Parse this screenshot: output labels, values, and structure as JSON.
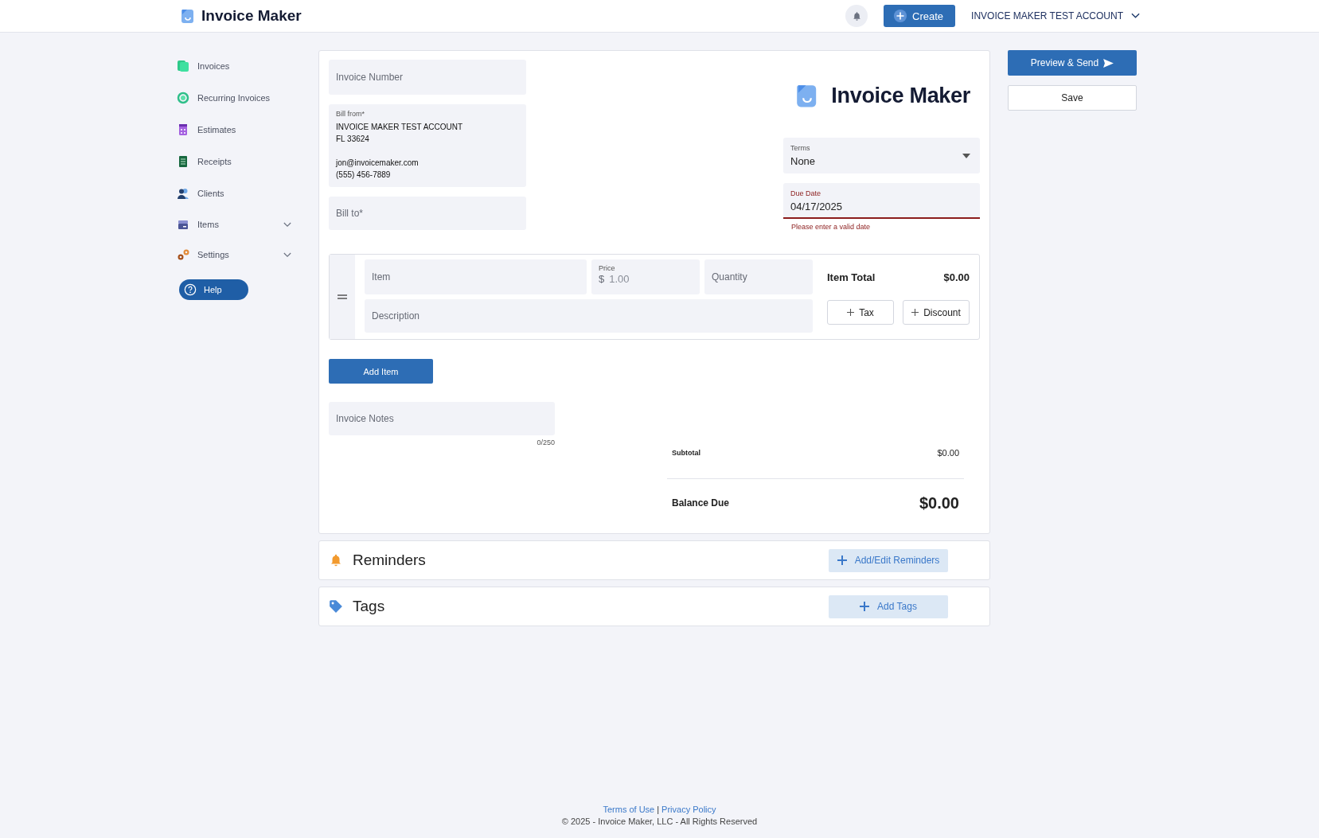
{
  "header": {
    "app_name": "Invoice Maker",
    "create_button": "Create",
    "account": "INVOICE MAKER TEST ACCOUNT"
  },
  "sidebar": {
    "items": [
      {
        "label": "Invoices",
        "kind": "invoices",
        "expandable": false
      },
      {
        "label": "Recurring Invoices",
        "kind": "recurring",
        "expandable": false
      },
      {
        "label": "Estimates",
        "kind": "estimates",
        "expandable": false
      },
      {
        "label": "Receipts",
        "kind": "receipts",
        "expandable": false
      },
      {
        "label": "Clients",
        "kind": "clients",
        "expandable": false
      },
      {
        "label": "Items",
        "kind": "items",
        "expandable": true
      },
      {
        "label": "Settings",
        "kind": "settings",
        "expandable": true
      }
    ],
    "help": "Help"
  },
  "invoice": {
    "invoice_number": {
      "placeholder": "Invoice Number"
    },
    "bill_from": {
      "label": "Bill from*",
      "blocks": [
        [
          "INVOICE MAKER TEST ACCOUNT",
          "FL 33624"
        ],
        [
          "jon@invoicemaker.com",
          "(555) 456-7889"
        ]
      ]
    },
    "bill_to": {
      "placeholder": "Bill to*"
    },
    "logo_text": "Invoice Maker",
    "terms": {
      "label": "Terms",
      "value": "None"
    },
    "due_date": {
      "label": "Due Date",
      "value": "04/17/2025",
      "error": "Please enter a valid date"
    },
    "line_items": [
      {
        "item": {
          "placeholder": "Item"
        },
        "price": {
          "label": "Price",
          "currency": "$",
          "placeholder": "1.00"
        },
        "quantity": {
          "placeholder": "Quantity"
        },
        "description": {
          "placeholder": "Description"
        },
        "total_label": "Item Total",
        "total": "$0.00",
        "tax_button": "Tax",
        "discount_button": "Discount"
      }
    ],
    "add_item_button": "Add Item",
    "notes": {
      "placeholder": "Invoice Notes",
      "counter": "0/250"
    },
    "subtotal_label": "Subtotal",
    "subtotal": "$0.00",
    "balance_label": "Balance Due",
    "balance": "$0.00"
  },
  "actions": {
    "preview_send": "Preview & Send",
    "save": "Save"
  },
  "sections": [
    {
      "kind": "reminders",
      "title": "Reminders",
      "button": "Add/Edit Reminders"
    },
    {
      "kind": "tags",
      "title": "Tags",
      "button": "Add Tags"
    }
  ],
  "footer": {
    "links": [
      "Terms of Use",
      "Privacy Policy"
    ],
    "separator": "|",
    "copyright": "© 2025 - Invoice Maker, LLC - All Rights Reserved"
  }
}
